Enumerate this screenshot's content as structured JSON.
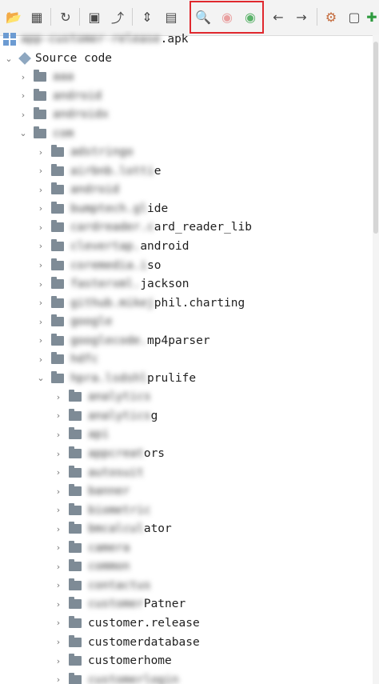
{
  "toolbar": {
    "icons": [
      {
        "name": "open-folder-icon",
        "glyph": "📂"
      },
      {
        "name": "add-file-icon",
        "glyph": "▦"
      },
      {
        "name": "refresh-icon",
        "glyph": "↻"
      },
      {
        "name": "save-icon",
        "glyph": "▣"
      },
      {
        "name": "export-icon",
        "glyph": "⤴"
      },
      {
        "name": "expand-icon",
        "glyph": "⇕"
      },
      {
        "name": "package-folder-icon",
        "glyph": "▤"
      },
      {
        "name": "search-icon",
        "glyph": "🔍"
      },
      {
        "name": "find-class-icon",
        "glyph": "◉"
      },
      {
        "name": "find-usage-icon",
        "glyph": "◉"
      },
      {
        "name": "back-icon",
        "glyph": "←"
      },
      {
        "name": "forward-icon",
        "glyph": "→"
      },
      {
        "name": "settings-panel-icon",
        "glyph": "⚙"
      },
      {
        "name": "decompile-icon",
        "glyph": "▢"
      },
      {
        "name": "plugin-icon",
        "glyph": "✚"
      }
    ],
    "highlight_color": "#e0282e"
  },
  "tree": {
    "root": {
      "label_blurred": "app-customer-release",
      "label_clear": ".apk"
    },
    "source_code": "Source code",
    "rows": [
      {
        "level": 1,
        "blur": "aaa",
        "clear": ""
      },
      {
        "level": 1,
        "blur": "android",
        "clear": ""
      },
      {
        "level": 1,
        "blur": "androidx",
        "clear": ""
      },
      {
        "level": 1,
        "blur": "com",
        "clear": "",
        "expanded": true
      },
      {
        "level": 2,
        "blur": "adstringo",
        "clear": ""
      },
      {
        "level": 2,
        "blur": "airbnb.lotti",
        "clear": "e"
      },
      {
        "level": 2,
        "blur": "android",
        "clear": ""
      },
      {
        "level": 2,
        "blur": "bumptech.gl",
        "clear": "ide"
      },
      {
        "level": 2,
        "blur": "cardreader.c",
        "clear": "ard_reader_lib"
      },
      {
        "level": 2,
        "blur": "clevertap.",
        "clear": "android"
      },
      {
        "level": 2,
        "blur": "coremedia.i",
        "clear": "so"
      },
      {
        "level": 2,
        "blur": "fasterxml.",
        "clear": "jackson"
      },
      {
        "level": 2,
        "blur": "github.mikej",
        "clear": "phil.charting"
      },
      {
        "level": 2,
        "blur": "google",
        "clear": ""
      },
      {
        "level": 2,
        "blur": "googlecode.",
        "clear": "mp4parser"
      },
      {
        "level": 2,
        "blur": "hdfc",
        "clear": ""
      },
      {
        "level": 2,
        "blur": "hpra.lsdshl",
        "clear": "prulife",
        "expanded": true
      },
      {
        "level": 3,
        "blur": "analytics",
        "clear": ""
      },
      {
        "level": 3,
        "blur": "analytics",
        "clear": "g"
      },
      {
        "level": 3,
        "blur": "api",
        "clear": ""
      },
      {
        "level": 3,
        "blur": "appcreat",
        "clear": "ors"
      },
      {
        "level": 3,
        "blur": "autosuit",
        "clear": ""
      },
      {
        "level": 3,
        "blur": "banner",
        "clear": ""
      },
      {
        "level": 3,
        "blur": "biometric",
        "clear": ""
      },
      {
        "level": 3,
        "blur": "bmcalcul",
        "clear": "ator"
      },
      {
        "level": 3,
        "blur": "camera",
        "clear": ""
      },
      {
        "level": 3,
        "blur": "common",
        "clear": ""
      },
      {
        "level": 3,
        "blur": "contactus",
        "clear": ""
      },
      {
        "level": 3,
        "blur": "customer",
        "clear": "Patner"
      },
      {
        "level": 3,
        "blur": "",
        "clear": "customer.release"
      },
      {
        "level": 3,
        "blur": "",
        "clear": "customerdatabase"
      },
      {
        "level": 3,
        "blur": "",
        "clear": "customerhome"
      },
      {
        "level": 3,
        "blur": "customerlogin",
        "clear": ""
      }
    ]
  }
}
